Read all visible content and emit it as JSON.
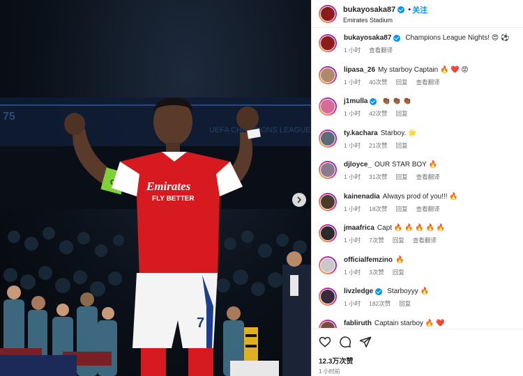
{
  "post": {
    "username": "bukayosaka87",
    "dot": "•",
    "follow_label": "关注",
    "location": "Emirates Stadium"
  },
  "photo": {
    "sponsor": "Emirates",
    "tagline": "FLY BETTER",
    "shirt_number": "7",
    "armband": "C",
    "banner_text": "UEFA CHAMPIONS LEAGUE",
    "board_text": "75",
    "colors": {
      "shirt_red": "#d71920",
      "shirt_white": "#ffffff",
      "sleeve_trim": "#1d3d8f"
    }
  },
  "comments": [
    {
      "user": "bukayosaka87",
      "verified": true,
      "text": "Champions League Nights! 😍 ⚽",
      "time": "1 小时",
      "likes": "",
      "reply": "",
      "translate": "查看翻译",
      "avatar": "#8a1c1c"
    },
    {
      "user": "lipasa_26",
      "verified": false,
      "text": "My starboy Captain 🔥 ❤️ 😡",
      "time": "1 小时",
      "likes": "40次赞",
      "reply": "回复",
      "translate": "查看翻译",
      "avatar": "#b08968"
    },
    {
      "user": "j1mulla",
      "verified": true,
      "text": "👏🏾 👏🏾 👏🏾",
      "time": "1 小时",
      "likes": "42次赞",
      "reply": "回复",
      "translate": "",
      "avatar": "#d66b9a"
    },
    {
      "user": "ty.kachara",
      "verified": false,
      "text": "Starboy. 🌟",
      "time": "1 小时",
      "likes": "21次赞",
      "reply": "回复",
      "translate": "",
      "avatar": "#5a6b7a"
    },
    {
      "user": "djloyce_",
      "verified": false,
      "text": "OUR STAR BOY 🔥",
      "time": "1 小时",
      "likes": "31次赞",
      "reply": "回复",
      "translate": "查看翻译",
      "avatar": "#8c7a8f"
    },
    {
      "user": "kainenadia",
      "verified": false,
      "text": "Always prod of you!!! 🔥",
      "time": "1 小时",
      "likes": "18次赞",
      "reply": "回复",
      "translate": "查看翻译",
      "avatar": "#4a3b2a"
    },
    {
      "user": "jmaafrica",
      "verified": false,
      "text": "Capt 🔥 🔥 🔥 🔥 🔥",
      "time": "1 小时",
      "likes": "7次赞",
      "reply": "回复",
      "translate": "查看翻译",
      "avatar": "#2b2b2b"
    },
    {
      "user": "officialfemzino",
      "verified": false,
      "text": "🔥",
      "time": "1 小时",
      "likes": "3次赞",
      "reply": "回复",
      "translate": "",
      "avatar": "#c9c9c9"
    },
    {
      "user": "livzledge",
      "verified": true,
      "text": "Starboyyy 🔥",
      "time": "1 小时",
      "likes": "182次赞",
      "reply": "回复",
      "translate": "",
      "avatar": "#3a2a3e"
    },
    {
      "user": "fabliruth",
      "verified": false,
      "text": "Captain starboy 🔥 ❤️",
      "time": "",
      "likes": "",
      "reply": "",
      "translate": "",
      "avatar": "#7a4a3a"
    }
  ],
  "footer": {
    "likes": "12.3万次赞",
    "time_ago": "1 小时前"
  }
}
